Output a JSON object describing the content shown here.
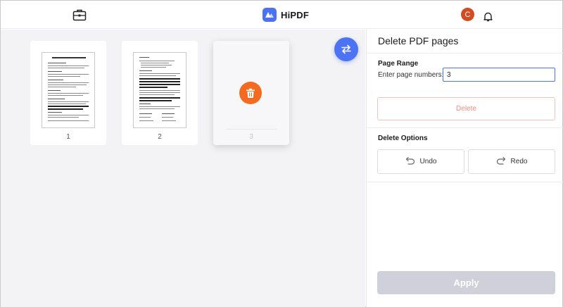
{
  "header": {
    "brand_name": "HiPDF",
    "avatar_initial": "C",
    "icons": [
      "briefcase-icon",
      "hipdf-logo-icon",
      "bell-icon"
    ]
  },
  "canvas": {
    "pages": [
      {
        "number": "1",
        "thumb_title": "Employment Contract Template"
      },
      {
        "number": "2",
        "thumb_title": ""
      },
      {
        "number": "3",
        "selected": true
      }
    ],
    "swap_icon": "swap-arrows-icon",
    "trash_icon": "trash-icon"
  },
  "panel": {
    "title": "Delete PDF pages",
    "page_range": {
      "heading": "Page Range",
      "label": "Enter page numbers:",
      "value": "3"
    },
    "delete_label": "Delete",
    "delete_options": {
      "heading": "Delete Options",
      "undo_label": "Undo",
      "redo_label": "Redo"
    },
    "apply_label": "Apply"
  },
  "colors": {
    "accent": "#4d73f5",
    "trash": "#f36b21",
    "avatar": "#d24b22",
    "delete_text": "#f08a83",
    "apply_disabled": "#cfd0da"
  }
}
